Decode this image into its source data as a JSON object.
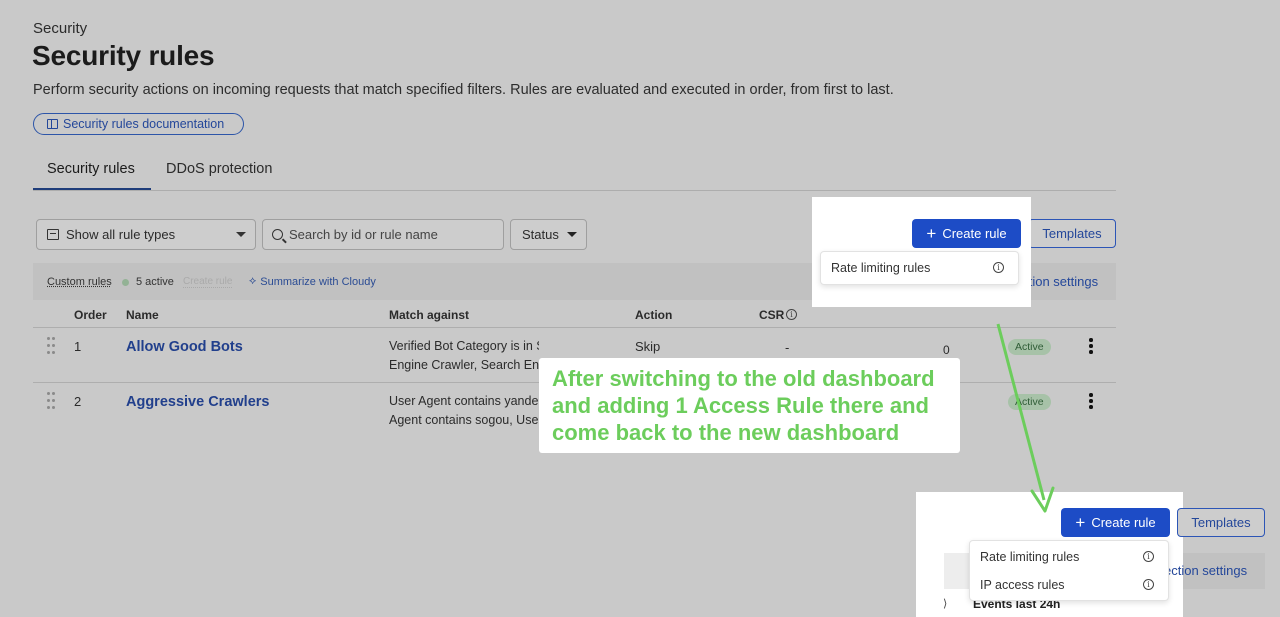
{
  "header": {
    "eyebrow": "Security",
    "title": "Security rules",
    "description": "Perform security actions on incoming requests that match specified filters. Rules are evaluated and executed in order, from first to last.",
    "doc_button": "Security rules documentation"
  },
  "tabs": [
    {
      "label": "Security rules",
      "active": true
    },
    {
      "label": "DDoS protection",
      "active": false
    }
  ],
  "filters": {
    "rule_types": "Show all rule types",
    "search_placeholder": "Search by id or rule name",
    "status": "Status"
  },
  "actions": {
    "create_rule": "Create rule",
    "templates": "Templates"
  },
  "subbar": {
    "custom_rules": "Custom rules",
    "active_count": "5 active",
    "create_rule_link": "Create rule",
    "summarize": "Summarize with Cloudy",
    "detection_settings": "ection settings"
  },
  "table": {
    "headers": {
      "order": "Order",
      "name": "Name",
      "match": "Match against",
      "action": "Action",
      "csr": "CSR",
      "events": "Events last 24h"
    },
    "rows": [
      {
        "order": "1",
        "name": "Allow Good Bots",
        "match_line1": "Verified Bot Category is in Search",
        "match_line2": "Engine Crawler, Search Eng",
        "action": "Skip",
        "csr": "-",
        "events": "0",
        "status": "Active"
      },
      {
        "order": "2",
        "name": "Aggressive Crawlers",
        "match_line1": "User Agent contains yande",
        "match_line2": "Agent contains sogou, Use",
        "action": "",
        "csr": "",
        "events": "",
        "status": "Active"
      }
    ]
  },
  "dropdown_before": {
    "items": [
      "Rate limiting rules"
    ]
  },
  "dropdown_after": {
    "items": [
      "Rate limiting rules",
      "IP access rules"
    ],
    "events_header": "Events last 24h",
    "detection_settings": "ection settings"
  },
  "annotation": {
    "text": "After switching to the old dashboard and adding 1 Access Rule there and come back to the new dashboard",
    "color": "#6ccd5c"
  },
  "colors": {
    "primary": "#1d4cc6",
    "link": "#24479a",
    "active_badge": "#a7c2a8"
  }
}
